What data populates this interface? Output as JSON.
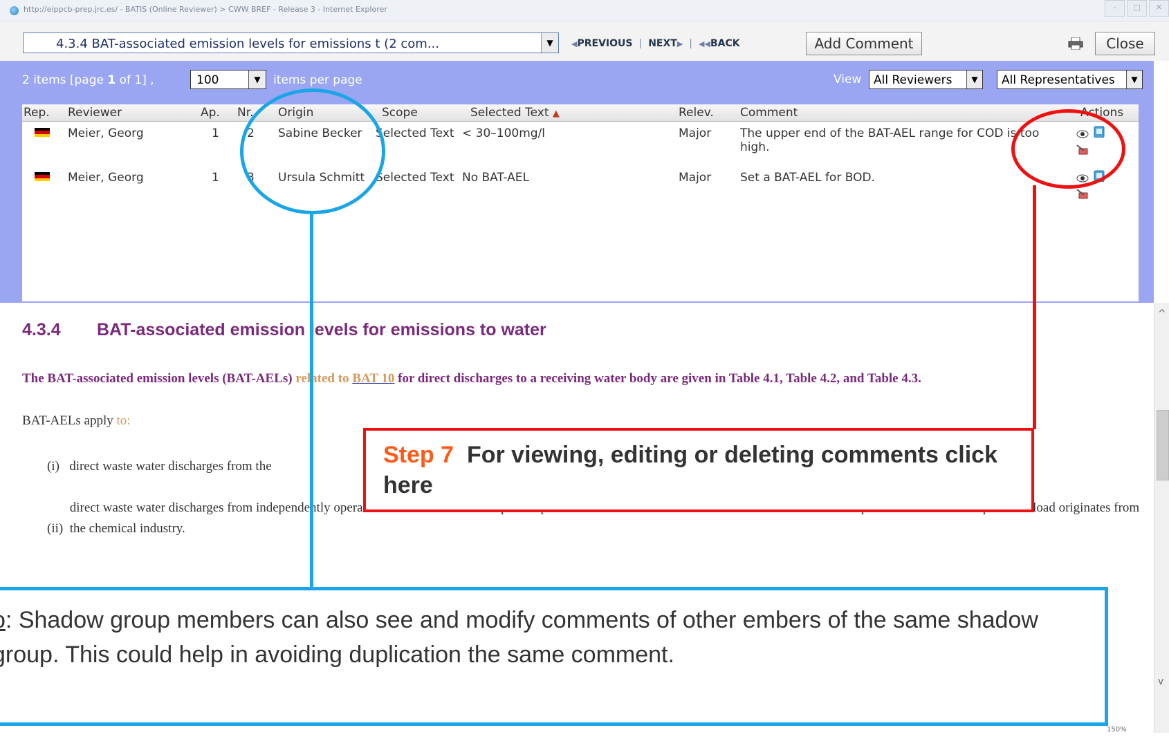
{
  "window": {
    "title": "http://eippcb-prep.jrc.es/ - BATIS (Online Reviewer) > CWW BREF - Release 3 - Internet Explorer",
    "buttons": [
      "–",
      "□",
      "✕"
    ]
  },
  "toolbar": {
    "section_value": "4.3.4  BAT-associated emission levels for emissions t (2 com...",
    "previous_label": "PREVIOUS",
    "next_label": "NEXT",
    "back_label": "BACK",
    "add_comment_label": "Add Comment",
    "close_label": "Close"
  },
  "panel": {
    "items_text": "2 items [page",
    "page_current": "1",
    "of_text": "of",
    "page_total": "1]",
    "per_page_value": "100",
    "per_page_label": "items per page",
    "view_label": "View",
    "reviewers_value": "All Reviewers",
    "representatives_value": "All Representatives"
  },
  "grid": {
    "headers": {
      "rep": "Rep.",
      "reviewer": "Reviewer",
      "ap": "Ap.",
      "nr": "Nr.",
      "origin": "Origin",
      "scope": "Scope",
      "selected_text": "Selected Text",
      "relev": "Relev.",
      "comment": "Comment",
      "actions": "Actions"
    },
    "rows": [
      {
        "reviewer": "Meier, Georg",
        "ap": "1",
        "nr": "2",
        "origin": "Sabine Becker",
        "scope": "Selected Text",
        "selected_text": "< 30–100mg/l",
        "relev": "Major",
        "comment": "The upper end of the BAT-AEL range for COD is too high."
      },
      {
        "reviewer": "Meier, Georg",
        "ap": "1",
        "nr": "3",
        "origin": "Ursula Schmitt",
        "scope": "Selected Text",
        "selected_text": "No BAT-AEL",
        "relev": "Major",
        "comment": "Set a BAT-AEL for BOD."
      }
    ],
    "flag_colors": [
      "#000000",
      "#dd0000",
      "#ffcc00"
    ]
  },
  "document": {
    "heading_number": "4.3.4",
    "heading_title": "BAT-associated emission levels for emissions to water",
    "para1_a": "The BAT-associated emission levels (BAT-AELs)",
    "para1_b": "related to",
    "para1_link": "BAT 10",
    "para1_c": "for direct discharges to a receiving water body are given in Table 4.1, Table 4.2, and Table 4.3.",
    "para2_a": "BAT-AELs apply",
    "para2_b": "to:",
    "item1_num": "(i)",
    "item1_text": "direct waste water discharges from the",
    "item2_num": "(ii)",
    "item2_text": "direct waste water discharges from independently operated waste water treatment plants specified in Section 6.11 of Annex I to Directive 2010/75/EU provided that the main pollutant load originates from the chemical industry."
  },
  "callouts": {
    "step_label": "Step 7",
    "step_text": "For viewing, editing or deleting comments click here",
    "note_underlined": "o",
    "note_text": ": Shadow group members can also see and modify comments of other embers of the same shadow group. This could help in avoiding duplication the same comment."
  },
  "statusbar": {
    "zoom": "150%"
  }
}
